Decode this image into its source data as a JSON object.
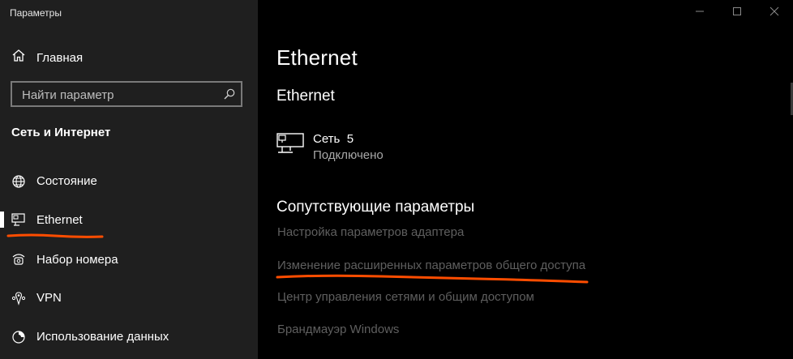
{
  "window": {
    "title": "Параметры",
    "controls": {
      "minimize_icon": "minimize-icon",
      "maximize_icon": "maximize-icon",
      "close_icon": "close-icon"
    }
  },
  "sidebar": {
    "home": {
      "label": "Главная",
      "icon": "home-icon"
    },
    "search": {
      "placeholder": "Найти параметр",
      "value": "",
      "icon": "search-icon"
    },
    "section_heading": "Сеть и Интернет",
    "items": [
      {
        "label": "Состояние",
        "icon": "globe-icon",
        "selected": false
      },
      {
        "label": "Ethernet",
        "icon": "ethernet-icon",
        "selected": true
      },
      {
        "label": "Набор номера",
        "icon": "dialup-icon",
        "selected": false
      },
      {
        "label": "VPN",
        "icon": "vpn-icon",
        "selected": false
      },
      {
        "label": "Использование данных",
        "icon": "data-usage-icon",
        "selected": false
      }
    ]
  },
  "main": {
    "page_title": "Ethernet",
    "subtitle": "Ethernet",
    "network": {
      "name": "Сеть  5",
      "status": "Подключено",
      "icon": "network-computer-icon"
    },
    "related_heading": "Сопутствующие параметры",
    "related_links": [
      "Настройка параметров адаптера",
      "Изменение расширенных параметров общего доступа",
      "Центр управления сетями и общим доступом",
      "Брандмауэр Windows"
    ]
  },
  "colors": {
    "sidebar_bg": "#1f1f1f",
    "main_bg": "#000000",
    "link_dim": "#5f5f5f",
    "annotation": "#ff4d00"
  }
}
